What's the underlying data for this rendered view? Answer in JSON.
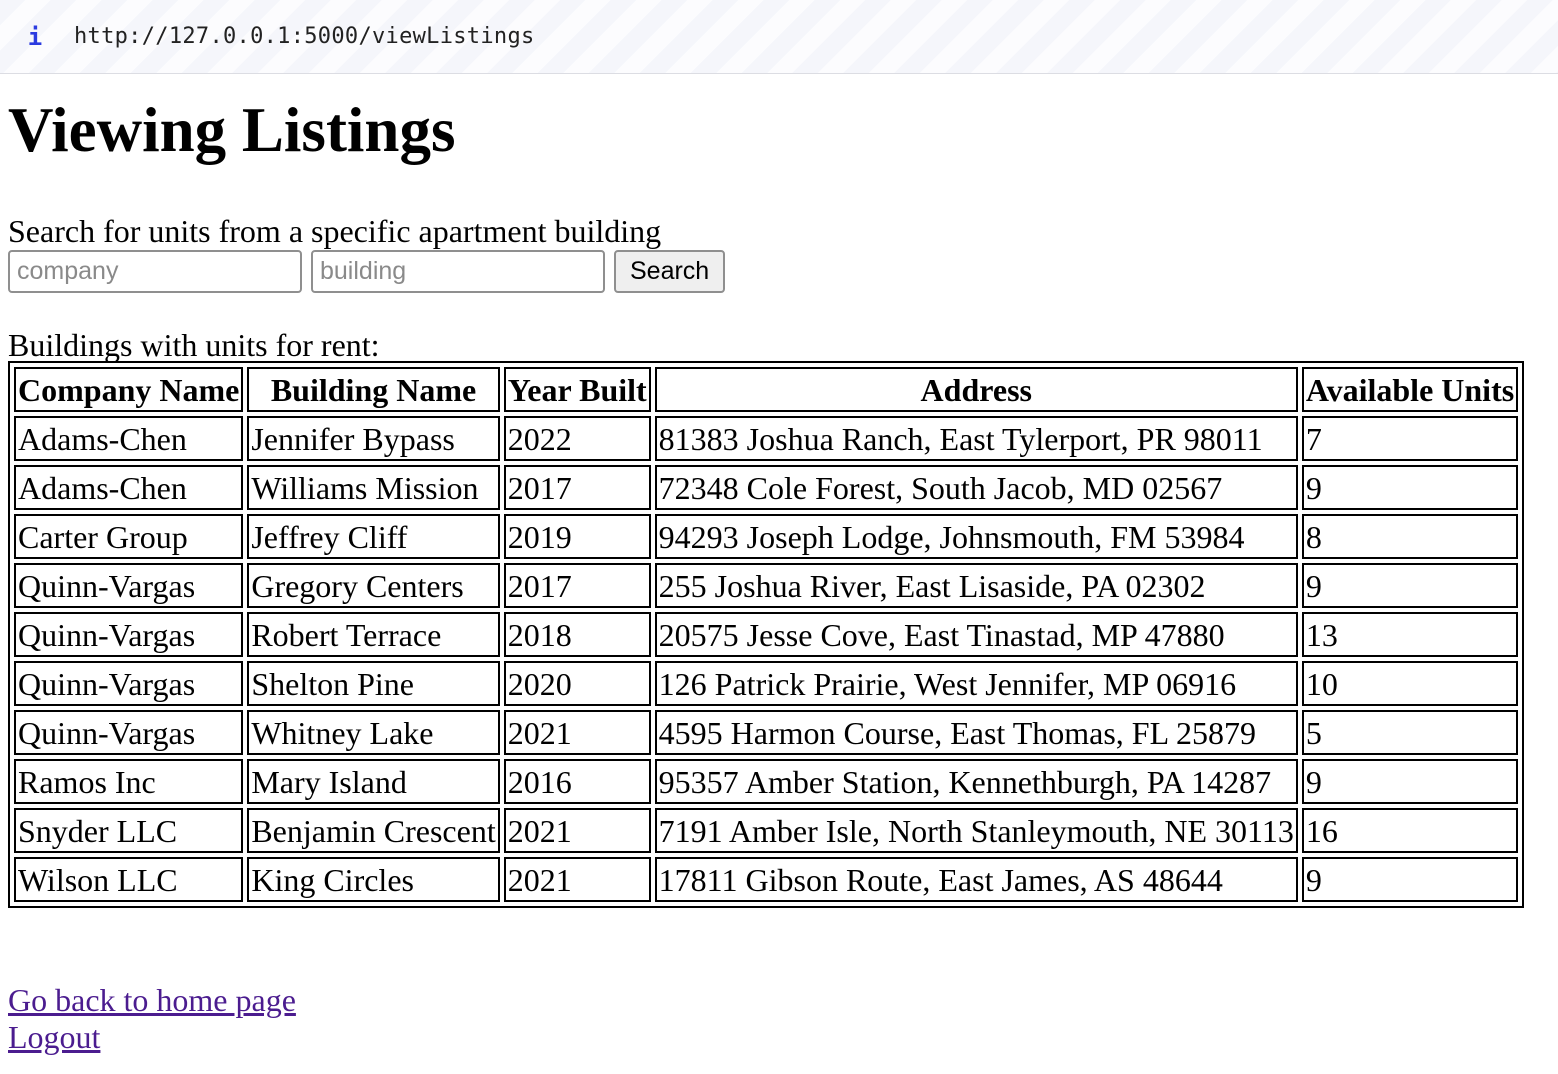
{
  "browser": {
    "url": "http://127.0.0.1:5000/viewListings",
    "info_icon": "i"
  },
  "page": {
    "title": "Viewing Listings",
    "search_label": "Search for units from a specific apartment building",
    "company_placeholder": "company",
    "building_placeholder": "building",
    "search_button": "Search",
    "buildings_label": "Buildings with units for rent:"
  },
  "table": {
    "headers": [
      "Company Name",
      "Building Name",
      "Year Built",
      "Address",
      "Available Units"
    ],
    "rows": [
      [
        "Adams-Chen",
        "Jennifer Bypass",
        "2022",
        "81383 Joshua Ranch, East Tylerport, PR 98011",
        "7"
      ],
      [
        "Adams-Chen",
        "Williams Mission",
        "2017",
        "72348 Cole Forest, South Jacob, MD 02567",
        "9"
      ],
      [
        "Carter Group",
        "Jeffrey Cliff",
        "2019",
        "94293 Joseph Lodge, Johnsmouth, FM 53984",
        "8"
      ],
      [
        "Quinn-Vargas",
        "Gregory Centers",
        "2017",
        "255 Joshua River, East Lisaside, PA 02302",
        "9"
      ],
      [
        "Quinn-Vargas",
        "Robert Terrace",
        "2018",
        "20575 Jesse Cove, East Tinastad, MP 47880",
        "13"
      ],
      [
        "Quinn-Vargas",
        "Shelton Pine",
        "2020",
        "126 Patrick Prairie, West Jennifer, MP 06916",
        "10"
      ],
      [
        "Quinn-Vargas",
        "Whitney Lake",
        "2021",
        "4595 Harmon Course, East Thomas, FL 25879",
        "5"
      ],
      [
        "Ramos Inc",
        "Mary Island",
        "2016",
        "95357 Amber Station, Kennethburgh, PA 14287",
        "9"
      ],
      [
        "Snyder LLC",
        "Benjamin Crescent",
        "2021",
        "7191 Amber Isle, North Stanleymouth, NE 30113",
        "16"
      ],
      [
        "Wilson LLC",
        "King Circles",
        "2021",
        "17811 Gibson Route, East James, AS 48644",
        "9"
      ]
    ]
  },
  "links": {
    "home": "Go back to home page",
    "logout": "Logout"
  }
}
